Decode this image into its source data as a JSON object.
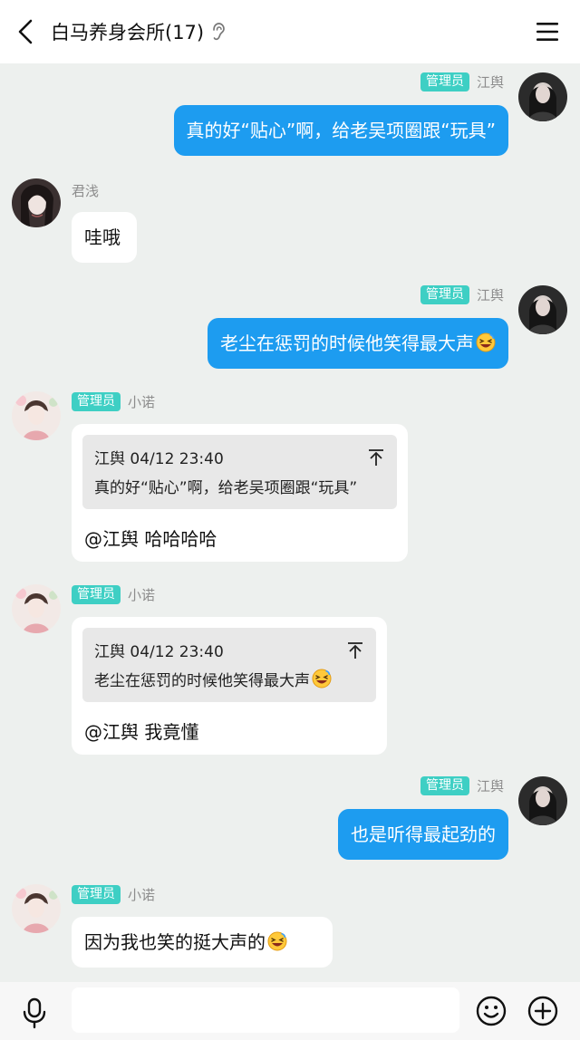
{
  "header": {
    "title": "白马养身会所(17)",
    "back_icon": "chevron-left-icon",
    "ear_icon": "ear-icon",
    "menu_icon": "hamburger-menu-icon"
  },
  "roles": {
    "admin_badge": "管理员"
  },
  "messages": [
    {
      "sender": "江舆",
      "is_admin": true,
      "side": "right",
      "text": "真的好“贴心”啊，给老吴项圈跟“玩具”"
    },
    {
      "sender": "君浅",
      "is_admin": false,
      "side": "left",
      "text": "哇哦"
    },
    {
      "sender": "江舆",
      "is_admin": true,
      "side": "right",
      "text": "老尘在惩罚的时候他笑得最大声",
      "emoji": "grinning-squint-emoji"
    },
    {
      "sender": "小诺",
      "is_admin": true,
      "side": "left",
      "quote": {
        "author_time": "江舆 04/12 23:40",
        "text": "真的好“贴心”啊，给老吴项圈跟“玩具”"
      },
      "text": "@江舆 哈哈哈哈"
    },
    {
      "sender": "小诺",
      "is_admin": true,
      "side": "left",
      "quote": {
        "author_time": "江舆 04/12 23:40",
        "text": "老尘在惩罚的时候他笑得最大声",
        "emoji": "grinning-squint-emoji"
      },
      "text": "@江舆 我竟懂"
    },
    {
      "sender": "江舆",
      "is_admin": true,
      "side": "right",
      "text": "也是听得最起劲的"
    },
    {
      "sender": "小诺",
      "is_admin": true,
      "side": "left",
      "text": "因为我也笑的挺大声的",
      "emoji": "grinning-squint-emoji"
    }
  ],
  "bottom_bar": {
    "voice_icon": "microphone-icon",
    "input_value": "",
    "emoji_icon": "smiley-icon",
    "plus_icon": "plus-circle-icon"
  },
  "colors": {
    "outgoing_bubble": "#1d9cf0",
    "admin_badge": "#3ecfc4",
    "chat_background": "#edf0ee"
  }
}
